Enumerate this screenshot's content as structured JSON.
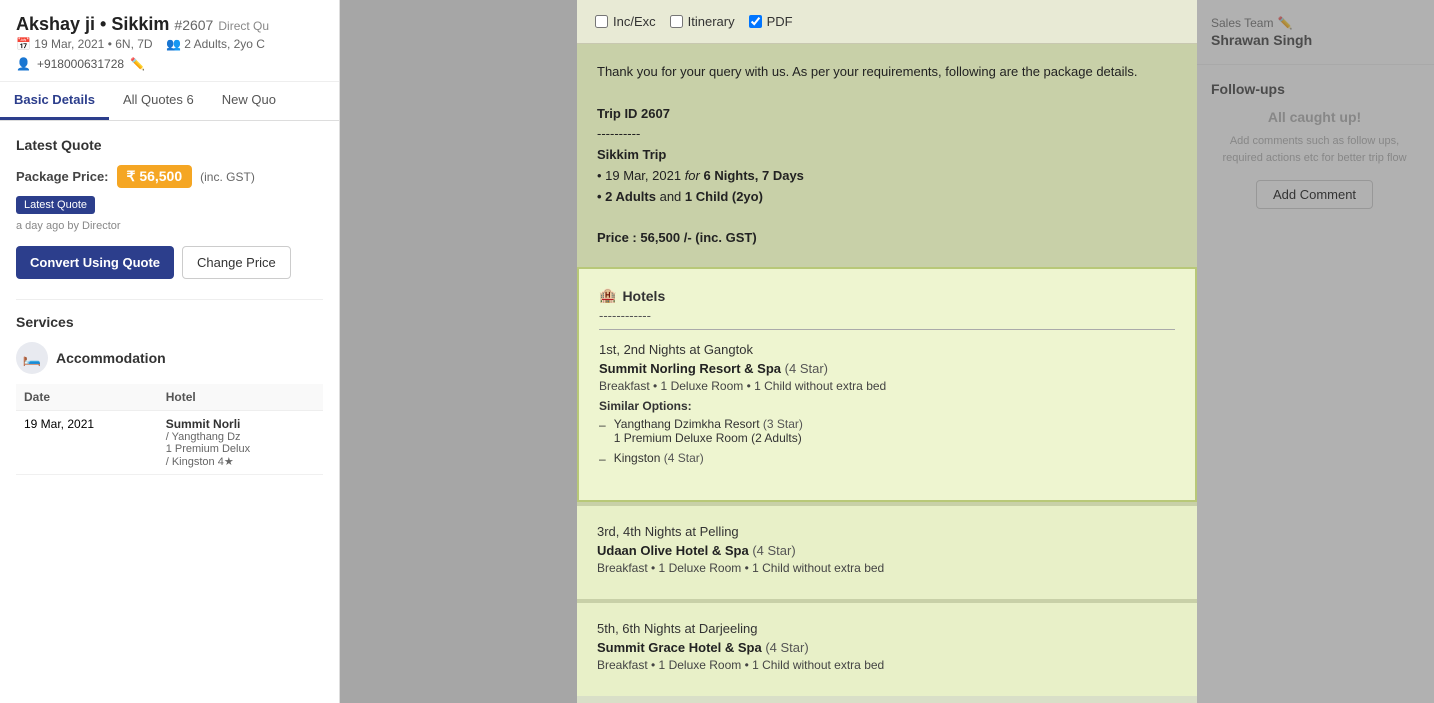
{
  "page": {
    "title": "Akshay ji • Sikkim"
  },
  "header": {
    "title": "Akshay ji • Sikkim",
    "trip_id": "#2607",
    "type": "Direct Qu",
    "date": "19 Mar, 2021",
    "duration": "6N, 7D",
    "guests": "2 Adults, 2yo C",
    "phone": "+918000631728"
  },
  "tabs": [
    {
      "label": "Basic Details",
      "active": true
    },
    {
      "label": "All Quotes",
      "count": "6",
      "active": false
    },
    {
      "label": "New Quo",
      "active": false
    }
  ],
  "latest_quote": {
    "section_title": "Latest Quote",
    "price_label": "Package Price:",
    "price": "₹ 56,500",
    "price_note": "(inc. GST)",
    "badge": "Latest Quote",
    "by": "a day ago by Director",
    "convert_btn": "Convert Using Quote",
    "change_price_btn": "Change Price"
  },
  "services": {
    "title": "Services",
    "accommodation": {
      "title": "Accommodation",
      "columns": [
        "Date",
        "Hotel"
      ],
      "rows": [
        {
          "date": "19 Mar, 2021",
          "hotel": "Summit Norli",
          "alt1": "Yangthang Dz",
          "alt1_sub": "1 Premium Delux",
          "alt2": "Kingston 4★"
        }
      ]
    }
  },
  "modal": {
    "checkboxes": [
      {
        "label": "Inc/Exc",
        "checked": false
      },
      {
        "label": "Itinerary",
        "checked": false
      },
      {
        "label": "PDF",
        "checked": true
      }
    ],
    "intro_text": {
      "line1": "Thank you for your query with us. As per your requirements, following are the package details.",
      "trip_id_label": "Trip ID 2607",
      "divider": "----------",
      "trip_name": "Sikkim Trip",
      "date_line": "• 19 Mar, 2021",
      "date_for": "for",
      "nights": "6 Nights, 7 Days",
      "guests_line": "• 2 Adults",
      "guests_and": "and",
      "child": "1 Child (2yo)",
      "price_line": "Price : 56,500 /- (inc. GST)"
    },
    "hotels": {
      "icon": "🏨",
      "title": "Hotels",
      "divider": "------------",
      "groups": [
        {
          "nights": "1st, 2nd Nights",
          "at": "at",
          "location": "Gangtok",
          "hotel_name": "Summit Norling Resort & Spa",
          "stars": "(4 Star)",
          "meal": "Breakfast • 1 Deluxe Room • 1 Child without extra bed",
          "similar_label": "Similar Options:",
          "similar": [
            {
              "name": "Yangthang Dzimkha Resort",
              "stars": "(3 Star)",
              "sub": "1 Premium Deluxe Room (2 Adults)"
            },
            {
              "name": "Kingston",
              "stars": "(4 Star)",
              "sub": null
            }
          ]
        },
        {
          "nights": "3rd, 4th Nights",
          "at": "at",
          "location": "Pelling",
          "hotel_name": "Udaan Olive Hotel & Spa",
          "stars": "(4 Star)",
          "meal": "Breakfast • 1 Deluxe Room • 1 Child without extra bed",
          "similar_label": null,
          "similar": []
        },
        {
          "nights": "5th, 6th Nights",
          "at": "at",
          "location": "Darjeeling",
          "hotel_name": "Summit Grace Hotel & Spa",
          "stars": "(4 Star)",
          "meal": "Breakfast • 1 Deluxe Room • 1 Child without extra bed",
          "similar_label": null,
          "similar": []
        }
      ]
    }
  },
  "right_panel": {
    "sales_team_label": "Sales Team",
    "sales_name": "Shrawan Singh",
    "followups": {
      "title": "Follow-ups",
      "caught_up": "All caught up!",
      "sub_text": "Add comments such as follow ups, required actions etc for better trip flow",
      "add_comment_btn": "Add Comment"
    }
  }
}
